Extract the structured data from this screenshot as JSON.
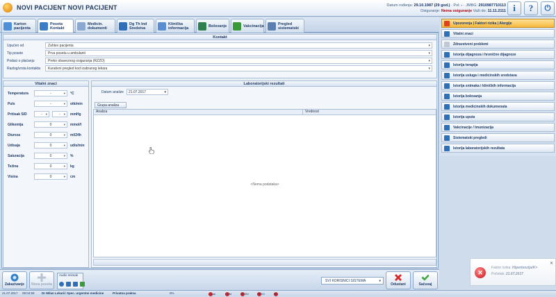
{
  "titlebar": {
    "title": "NOVI PACIJENT  NOVI PACIJENT",
    "dob_label": "Datum rođenja:",
    "dob_value": "29.10.1987 (29 god.)",
    "sex_label": "Pol:",
    "sex_value": "-",
    "jmbg_label": "JMBG:",
    "jmbg_value": "2910987710113",
    "insured_label": "Osiguranje:",
    "insured_value": "Nema osiguranje",
    "valid_label": "Važi do:",
    "valid_value": "11.11.2111",
    "btn_info": "i",
    "btn_help": "?",
    "btn_exit": "⏻"
  },
  "tabs": [
    {
      "label": "Karton pacijenta",
      "icon": "folder-icon",
      "color": "#4f8fd8"
    },
    {
      "label": "Poseta Kontakt",
      "icon": "visit-icon",
      "color": "#3c7cc6"
    },
    {
      "label": "Medicin. dokumenti",
      "icon": "documents-icon",
      "color": "#8aa8d0"
    },
    {
      "label": "Dg Th Ind Sredstva",
      "icon": "diagnosis-icon",
      "color": "#2f6fb8"
    },
    {
      "label": "Klinička informacija",
      "icon": "clinical-icon",
      "color": "#5b8ed0"
    },
    {
      "label": "Bolovanje",
      "icon": "sick-leave-icon",
      "color": "#2f7f4f"
    },
    {
      "label": "Vakcinacija",
      "icon": "vaccine-icon",
      "color": "#3a9a3a"
    },
    {
      "label": "Pregled sistematski",
      "icon": "checkup-icon",
      "color": "#5a7fb0"
    }
  ],
  "kontakt": {
    "title": "Kontakt",
    "rows": [
      {
        "label": "Upućen od",
        "value": "Zahtev pacijenta"
      },
      {
        "label": "Tip posete",
        "value": "Prva poseta u ambulanti"
      },
      {
        "label": "Podaci o plaćanju",
        "value": "Preko obaveznog osiguranja (RZZO)"
      },
      {
        "label": "Razlog/vrsta kontakta",
        "value": "Kurativni pregled kod izabranog lekara"
      }
    ]
  },
  "vitals": {
    "title": "Vitalni znaci",
    "rows": [
      {
        "label": "Temperatura",
        "value": "-",
        "unit": "°C",
        "split": false
      },
      {
        "label": "Puls",
        "value": "-",
        "unit": "otk/min",
        "split": false
      },
      {
        "label": "Pritisak S/D",
        "value": "-",
        "value2": "-",
        "unit": "mmHg",
        "split": true
      },
      {
        "label": "Glikemija",
        "value": "0",
        "unit": "mmol/l",
        "split": false
      },
      {
        "label": "Diureza",
        "value": "0",
        "unit": "ml/24h",
        "split": false
      },
      {
        "label": "Udisaja",
        "value": "0",
        "unit": "udis/min",
        "split": false
      },
      {
        "label": "Saturacija",
        "value": "0",
        "unit": "%",
        "split": false
      },
      {
        "label": "Težina",
        "value": "0",
        "unit": "kg",
        "split": false
      },
      {
        "label": "Visina",
        "value": "0",
        "unit": "cm",
        "split": false
      }
    ]
  },
  "lab": {
    "title": "Laboratorijski rezultati",
    "date_label": "Datum analize",
    "date_value": "21.07.2017",
    "group_button": "Grupa analiza",
    "col_analiza": "Analiza",
    "col_vrednost": "Vrednost",
    "empty": "<Nema podataka>"
  },
  "sidebar": [
    {
      "label": "Upozorenja | Faktori rizika | Alergije",
      "icon": "warning-icon",
      "color": "#e0441c",
      "active": true
    },
    {
      "label": "Vitalni znaci",
      "icon": "vitals-icon",
      "color": "#2f6fb8",
      "active": false
    },
    {
      "label": "Zdravstveni problemi",
      "icon": "health-icon",
      "color": "#c0c8d4",
      "active": false
    },
    {
      "label": "Istorija dijagnoza i hronične dijagnoze",
      "icon": "diagnosis-history-icon",
      "color": "#2f6fb8",
      "active": false
    },
    {
      "label": "Istorija terapija",
      "icon": "therapy-icon",
      "color": "#2f6fb8",
      "active": false
    },
    {
      "label": "Istorija usluga i medicinskih sredstava",
      "icon": "services-icon",
      "color": "#2f6fb8",
      "active": false
    },
    {
      "label": "Istorija snimaka i kliničkih informacija",
      "icon": "imaging-icon",
      "color": "#2f6fb8",
      "active": false
    },
    {
      "label": "Istorija bolovanja",
      "icon": "sick-leave-history-icon",
      "color": "#2f6fb8",
      "active": false
    },
    {
      "label": "Istorija medicinskih dokumenata",
      "icon": "documents-history-icon",
      "color": "#2f6fb8",
      "active": false
    },
    {
      "label": "Istorija uputa",
      "icon": "referral-icon",
      "color": "#2f6fb8",
      "active": false
    },
    {
      "label": "Vakcinacije / Imunizacija",
      "icon": "shield-icon",
      "color": "#2f6fb8",
      "active": false
    },
    {
      "label": "Sistematski pregledi",
      "icon": "checkup-history-icon",
      "color": "#2f6fb8",
      "active": false
    },
    {
      "label": "Istorija laboratorijskih rezultata",
      "icon": "lab-icon",
      "color": "#2f6fb8",
      "active": false
    }
  ],
  "bottombar": {
    "zakazivanje": "Zakazivanje",
    "nova_poseta": "Nova poseta",
    "audio_label": "Audio snimak",
    "users_select": "SVI KORISNICI SISTEMA",
    "odustani": "Odustani",
    "sacuvaj": "Sačuvaj"
  },
  "statusbar": {
    "date": "21.07.2017",
    "time": "09:04:59",
    "user": "Dr Milan Lekarić Spec. urgentne medicine",
    "practice": "Privatna praksa",
    "progress": "0%",
    "indicators": [
      "e-Lab",
      "DCM",
      "DICBV",
      "RFZO",
      "RIL"
    ]
  },
  "notification": {
    "line1_label": "Faktor rizika:",
    "line1_value": "Hipertenzija/K>",
    "line2_label": "Početak:",
    "line2_value": "21.07.2017"
  }
}
